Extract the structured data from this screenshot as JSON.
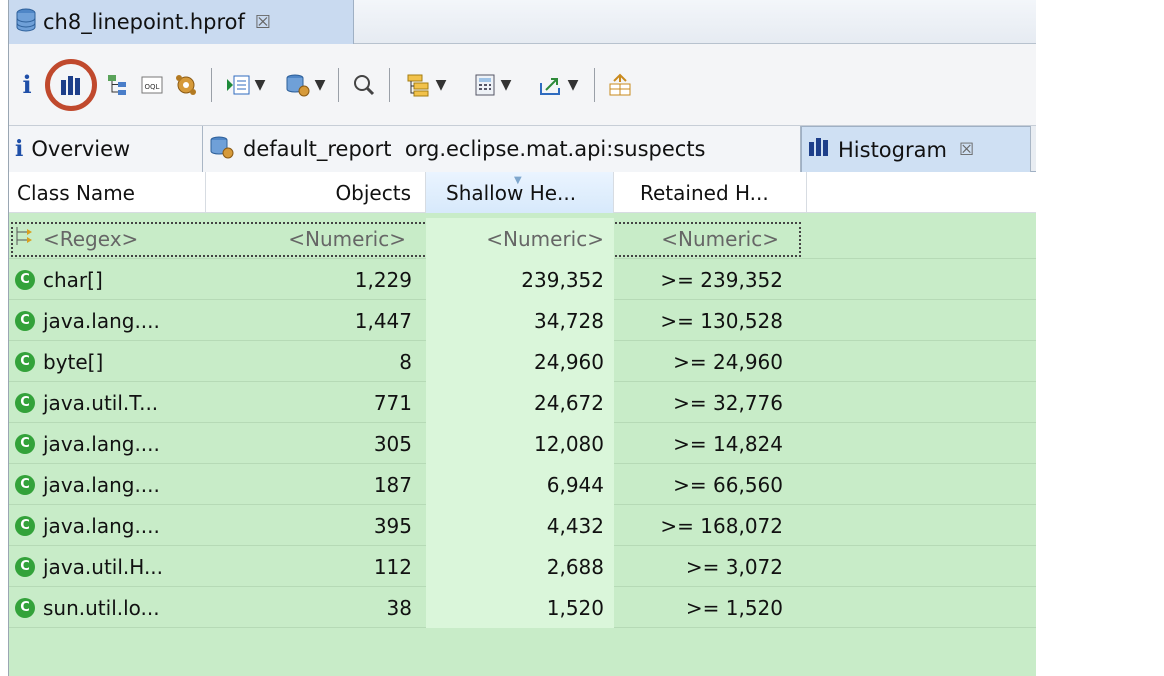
{
  "editor": {
    "tab_title": "ch8_linepoint.hprof",
    "tab_close_glyph": "☒"
  },
  "toolbar": {
    "items": [
      "info-icon",
      "histogram-icon",
      "dominator-tree-icon",
      "oql-icon",
      "heap-dump-overview-icon",
      "query-browser-icon",
      "reports-icon",
      "search-icon",
      "group-by-icon",
      "calculate-retained-icon",
      "export-icon",
      "link-editors-icon"
    ]
  },
  "tabs": {
    "overview": "Overview",
    "report": "default_report  org.eclipse.mat.api:suspects",
    "histogram": "Histogram",
    "close_glyph": "☒"
  },
  "table": {
    "columns": [
      "Class Name",
      "Objects",
      "Shallow He...",
      "Retained H..."
    ],
    "filters": [
      "<Regex>",
      "<Numeric>",
      "<Numeric>",
      "<Numeric>"
    ],
    "rows": [
      [
        "char[]",
        "1,229",
        "239,352",
        ">= 239,352"
      ],
      [
        "java.lang....",
        "1,447",
        "34,728",
        ">= 130,528"
      ],
      [
        "byte[]",
        "8",
        "24,960",
        ">= 24,960"
      ],
      [
        "java.util.T...",
        "771",
        "24,672",
        ">= 32,776"
      ],
      [
        "java.lang....",
        "305",
        "12,080",
        ">= 14,824"
      ],
      [
        "java.lang....",
        "187",
        "6,944",
        ">= 66,560"
      ],
      [
        "java.lang....",
        "395",
        "4,432",
        ">= 168,072"
      ],
      [
        "java.util.H...",
        "112",
        "2,688",
        ">= 3,072"
      ],
      [
        "sun.util.lo...",
        "38",
        "1,520",
        ">= 1,520"
      ]
    ]
  },
  "colors": {
    "row_bg": "#c8ecc8",
    "sorted_col_bg": "#daf6da",
    "highlight_ring": "#c0492d",
    "class_icon": "#33a23a"
  }
}
